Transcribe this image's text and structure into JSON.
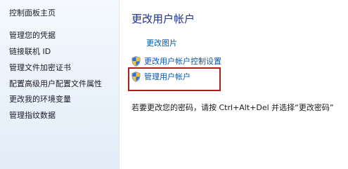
{
  "sidebar": {
    "home_label": "控制面板主页",
    "items": [
      {
        "label": "管理您的凭据"
      },
      {
        "label": "链接联机 ID"
      },
      {
        "label": "管理文件加密证书"
      },
      {
        "label": "配置高级用户配置文件属性"
      },
      {
        "label": "更改我的环境变量"
      },
      {
        "label": "管理指纹数据"
      }
    ]
  },
  "main": {
    "title": "更改用户帐户",
    "tasks": {
      "change_picture": "更改图片",
      "uac_settings": "更改用户帐户控制设置",
      "manage_accounts": "管理用户帐户"
    },
    "hint": "若要更改您的密码，请按 Ctrl+Alt+Del 并选择“更改密码”"
  },
  "colors": {
    "title": "#1e3287",
    "link": "#0b57a8",
    "highlight_border": "#b01c1c",
    "sidebar_bg": "#e9f1fa"
  },
  "icons": {
    "uac": "uac-shield-icon"
  }
}
